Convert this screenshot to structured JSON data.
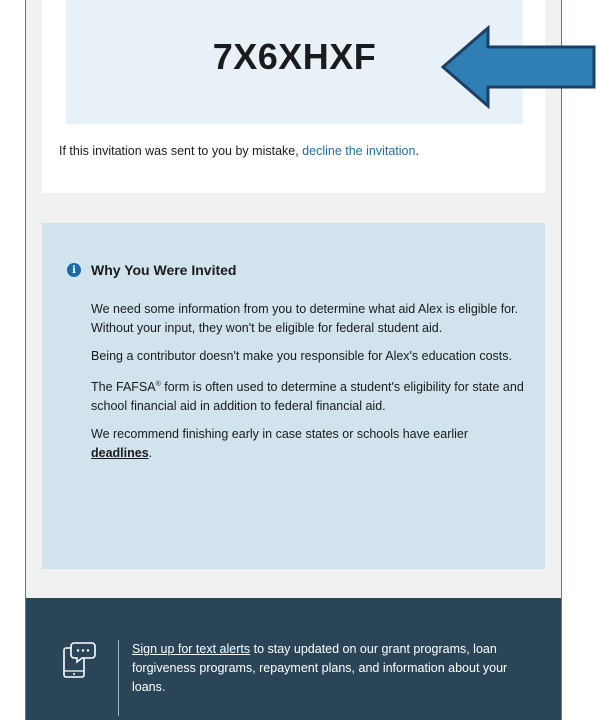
{
  "invitation": {
    "code": "7X6XHXF",
    "mistake_prefix": "If this invitation was sent to you by mistake, ",
    "decline_link": "decline the invitation",
    "mistake_suffix": "."
  },
  "why_invited": {
    "title": "Why You Were Invited",
    "paragraph1": "We need some information from you to determine what aid Alex is eligible for. Without your input, they won't be eligible for federal student aid.",
    "paragraph2": "Being a contributor doesn't make you responsible for Alex's education costs.",
    "paragraph3_a": "The FAFSA",
    "paragraph3_reg": "®",
    "paragraph3_b": " form is often used to determine a student's eligibility for state and school financial aid in addition to federal financial aid.",
    "paragraph4_prefix": "We recommend finishing early in case states or schools have earlier ",
    "deadlines_link": "deadlines",
    "paragraph4_suffix": "."
  },
  "footer": {
    "signup_link": "Sign up for text alerts",
    "text": " to stay updated on our grant programs, loan forgiveness programs, repayment plans, and information about your loans."
  },
  "colors": {
    "code_box_bg": "#e8f1f8",
    "info_box_bg": "#d1e3ec",
    "footer_bg": "#2b4558",
    "link_blue": "#1f6fa3",
    "arrow_fill": "#2f7fb5",
    "arrow_stroke": "#1b3f66"
  },
  "icons": {
    "info": "info-circle-icon",
    "footer": "phone-chat-icon",
    "annotation": "left-arrow-annotation"
  }
}
